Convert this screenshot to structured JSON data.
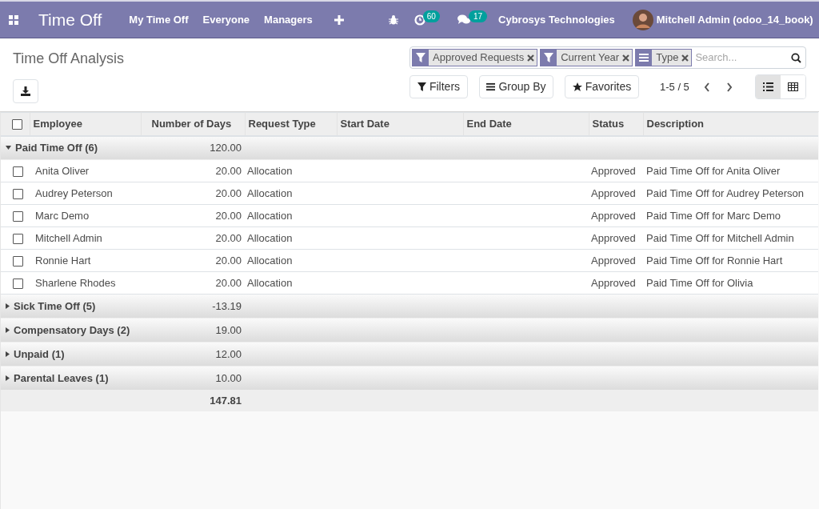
{
  "navbar": {
    "app_title": "Time Off",
    "menu": [
      "My Time Off",
      "Everyone",
      "Managers"
    ],
    "activity_count": "60",
    "message_count": "17",
    "company": "Cybrosys Technologies",
    "user": "Mitchell Admin (odoo_14_book)"
  },
  "control_panel": {
    "title": "Time Off Analysis",
    "facets": [
      {
        "kind": "filter",
        "label": "Approved Requests"
      },
      {
        "kind": "filter",
        "label": "Current Year"
      },
      {
        "kind": "groupby",
        "label": "Type"
      }
    ],
    "search": {
      "placeholder": "Search..."
    },
    "buttons": [
      "Filters",
      "Group By",
      "Favorites"
    ],
    "pager": "1-5 / 5",
    "views": [
      {
        "kind": "list",
        "selected": true
      },
      {
        "kind": "pivot",
        "selected": false
      }
    ]
  },
  "table": {
    "all_checked": false,
    "columns": [
      "Employee",
      "Number of Days",
      "Request Type",
      "Start Date",
      "End Date",
      "Status",
      "Description"
    ],
    "groups": [
      {
        "label": "Paid Time Off (6)",
        "total": "120.00",
        "expanded": true,
        "rows": [
          {
            "checked": false,
            "employee": "Anita Oliver",
            "days": "20.00",
            "type": "Allocation",
            "status": "Approved",
            "description": "Paid Time Off for Anita Oliver"
          },
          {
            "checked": false,
            "employee": "Audrey Peterson",
            "days": "20.00",
            "type": "Allocation",
            "status": "Approved",
            "description": "Paid Time Off for Audrey Peterson"
          },
          {
            "checked": false,
            "employee": "Marc Demo",
            "days": "20.00",
            "type": "Allocation",
            "status": "Approved",
            "description": "Paid Time Off for Marc Demo"
          },
          {
            "checked": false,
            "employee": "Mitchell Admin",
            "days": "20.00",
            "type": "Allocation",
            "status": "Approved",
            "description": "Paid Time Off for Mitchell Admin"
          },
          {
            "checked": false,
            "employee": "Ronnie Hart",
            "days": "20.00",
            "type": "Allocation",
            "status": "Approved",
            "description": "Paid Time Off for Ronnie Hart"
          },
          {
            "checked": false,
            "employee": "Sharlene Rhodes",
            "days": "20.00",
            "type": "Allocation",
            "status": "Approved",
            "description": "Paid Time Off for Olivia"
          }
        ]
      },
      {
        "label": "Sick Time Off (5)",
        "total": "-13.19",
        "expanded": false
      },
      {
        "label": "Compensatory Days (2)",
        "total": "19.00",
        "expanded": false
      },
      {
        "label": "Unpaid (1)",
        "total": "12.00",
        "expanded": false
      },
      {
        "label": "Parental Leaves (1)",
        "total": "10.00",
        "expanded": false
      }
    ],
    "grand_total": "147.81"
  }
}
